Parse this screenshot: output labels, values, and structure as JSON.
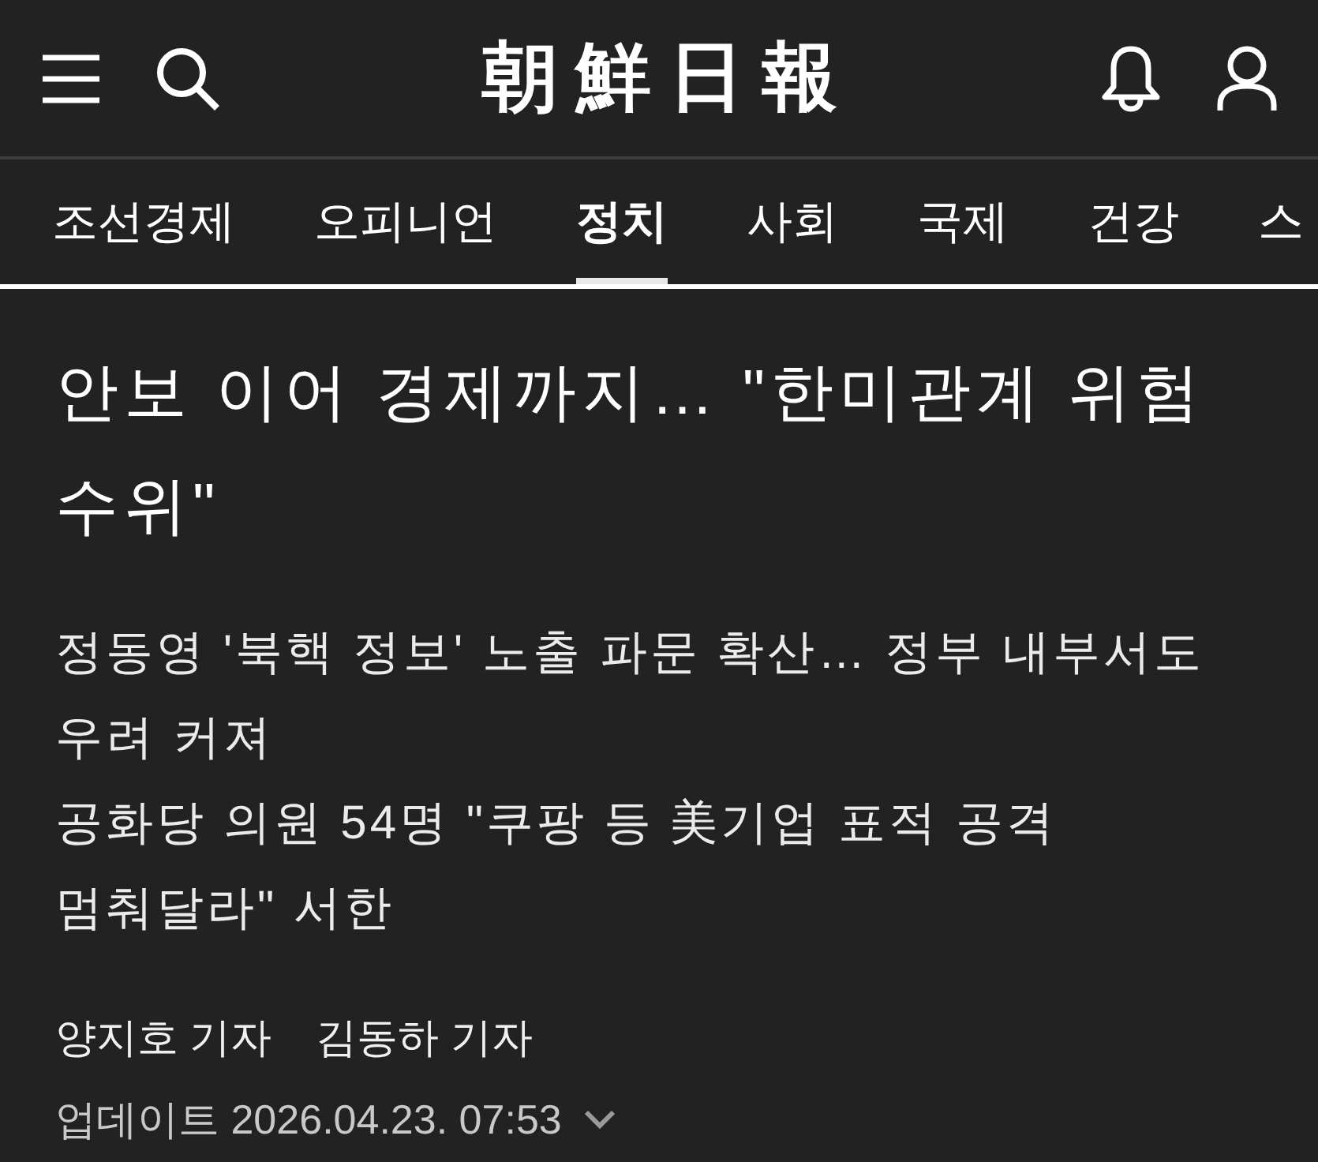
{
  "header": {
    "logo": "朝鮮日報"
  },
  "nav": {
    "tabs": [
      {
        "label": "조선경제",
        "selected": false
      },
      {
        "label": "오피니언",
        "selected": false
      },
      {
        "label": "정치",
        "selected": true
      },
      {
        "label": "사회",
        "selected": false
      },
      {
        "label": "국제",
        "selected": false
      },
      {
        "label": "건강",
        "selected": false
      },
      {
        "label": "스",
        "selected": false
      }
    ]
  },
  "article": {
    "headline": "안보 이어 경제까지… \"한미관계 위험 수위\"",
    "subheadlines": [
      "정동영 '북핵 정보' 노출 파문 확산… 정부 내부서도 우려 커져",
      "공화당 의원 54명 \"쿠팡 등 美기업 표적 공격 멈춰달라\" 서한"
    ],
    "authors": [
      "양지호 기자",
      "김동하 기자"
    ],
    "updated": {
      "text": "업데이트 2026.04.23. 07:53",
      "expanded": false
    }
  }
}
